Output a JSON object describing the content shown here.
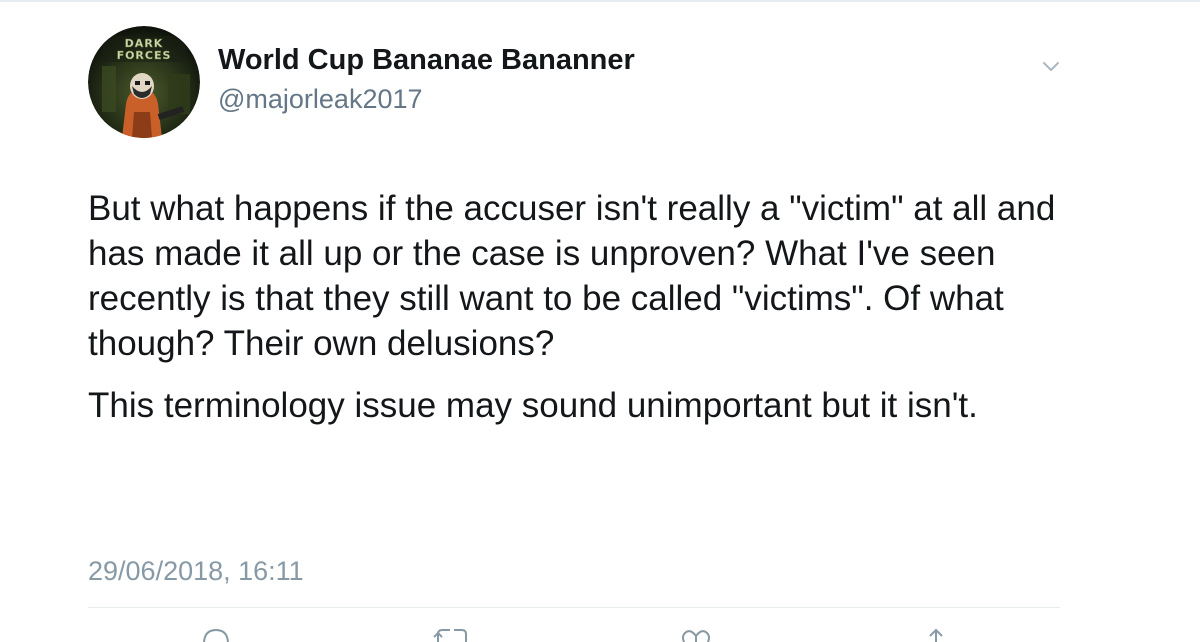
{
  "user": {
    "display_name": "World Cup Bananae Bananner",
    "handle": "@majorleak2017",
    "avatar_text": "DARK FORCES",
    "avatar_icon": "dark-forces-stormtrooper-avatar"
  },
  "tweet": {
    "paragraphs": [
      "But what happens if the accuser isn't really a \"victim\" at all and has made it all up or the case is unproven? What I've seen recently is that they still want to be called \"victims\". Of what though? Their own delusions?",
      "This terminology issue may sound unimportant but it isn't."
    ],
    "timestamp": "29/06/2018, 16:11"
  },
  "actions": {
    "reply_icon": "reply-icon",
    "retweet_icon": "retweet-icon",
    "like_icon": "heart-icon",
    "share_icon": "share-icon"
  },
  "menu": {
    "icon": "chevron-down-icon"
  },
  "colors": {
    "text": "#14171a",
    "secondary": "#657786",
    "timestamp": "#8899a6",
    "divider": "#e6ecf0",
    "icon": "#8899a6"
  }
}
